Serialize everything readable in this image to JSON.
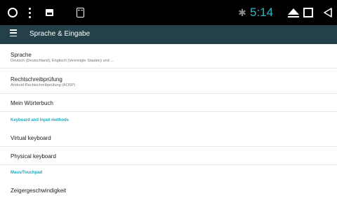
{
  "status_bar": {
    "time": "5:14",
    "time_color": "#29b6c8",
    "left_icons": [
      "circle-icon",
      "more-vert-icon",
      "image-icon",
      "sd-card-icon"
    ],
    "right_icons": [
      "bluetooth-icon",
      "eject-icon",
      "square-icon",
      "back-icon"
    ]
  },
  "app_bar": {
    "title": "Sprache & Eingabe",
    "background": "#24414a"
  },
  "list": {
    "items": [
      {
        "title": "Sprache",
        "summary": "Deutsch (Deutschland), Englisch (Vereinigte Staaten) und ..."
      },
      {
        "title": "Rechtschreibprüfung",
        "summary": "Android-Rechtschreibprüfung (AOSP)"
      },
      {
        "title": "Mein Wörterbuch"
      },
      {
        "category": "Keyboard and input methods"
      },
      {
        "title": "Virtual keyboard"
      },
      {
        "title": "Physical keyboard"
      },
      {
        "category": "Maus/Touchpad"
      },
      {
        "title": "Zeigergeschwindigkeit"
      }
    ]
  },
  "accent_color": "#26a6b8"
}
